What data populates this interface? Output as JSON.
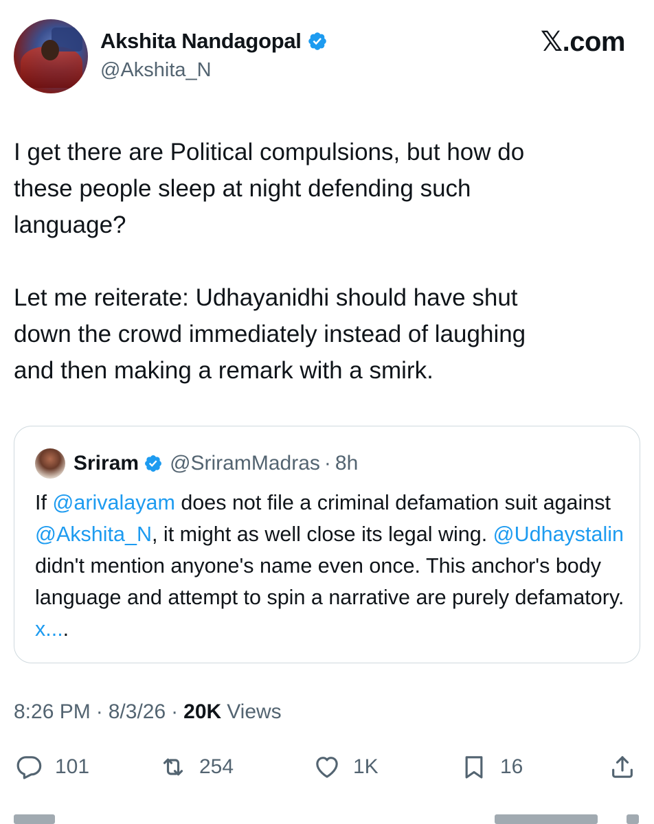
{
  "author": {
    "display_name": "Akshita Nandagopal",
    "handle": "@Akshita_N",
    "verified_icon": "verified-badge-icon"
  },
  "brand": "𝕏.com",
  "post": {
    "text": "I get there are Political compulsions, but how do\nthese people sleep at night defending such\nlanguage?\n\nLet me reiterate: Udhayanidhi should have shut\ndown the crowd immediately instead of laughing\nand then making a remark with a smirk."
  },
  "quote": {
    "name": "Sriram",
    "handle": "@SriramMadras",
    "separator": "·",
    "time": "8h",
    "text_parts": [
      {
        "t": "If ",
        "m": false
      },
      {
        "t": "@arivalayam",
        "m": true
      },
      {
        "t": " does not file a criminal defamation suit against ",
        "m": false
      },
      {
        "t": "@Akshita_N",
        "m": true
      },
      {
        "t": ", it might as well close its legal wing. ",
        "m": false
      },
      {
        "t": "@Udhaystalin",
        "m": true
      },
      {
        "t": " didn't mention anyone's name even once. This anchor's body language and attempt to spin a narrative are purely defamatory. ",
        "m": false
      },
      {
        "t": "x...",
        "m": true
      },
      {
        "t": ".",
        "m": false
      }
    ]
  },
  "meta": {
    "time": "8:26 PM",
    "dot1": "·",
    "date": "8/3/26",
    "dot2": "·",
    "views_count": "20K",
    "views_label": "Views"
  },
  "actions": {
    "replies": "101",
    "reposts": "254",
    "likes": "1K",
    "bookmarks": "16"
  },
  "colors": {
    "text": "#0f1419",
    "secondary": "#536471",
    "link": "#1d9bf0",
    "border": "#cfd9de"
  }
}
